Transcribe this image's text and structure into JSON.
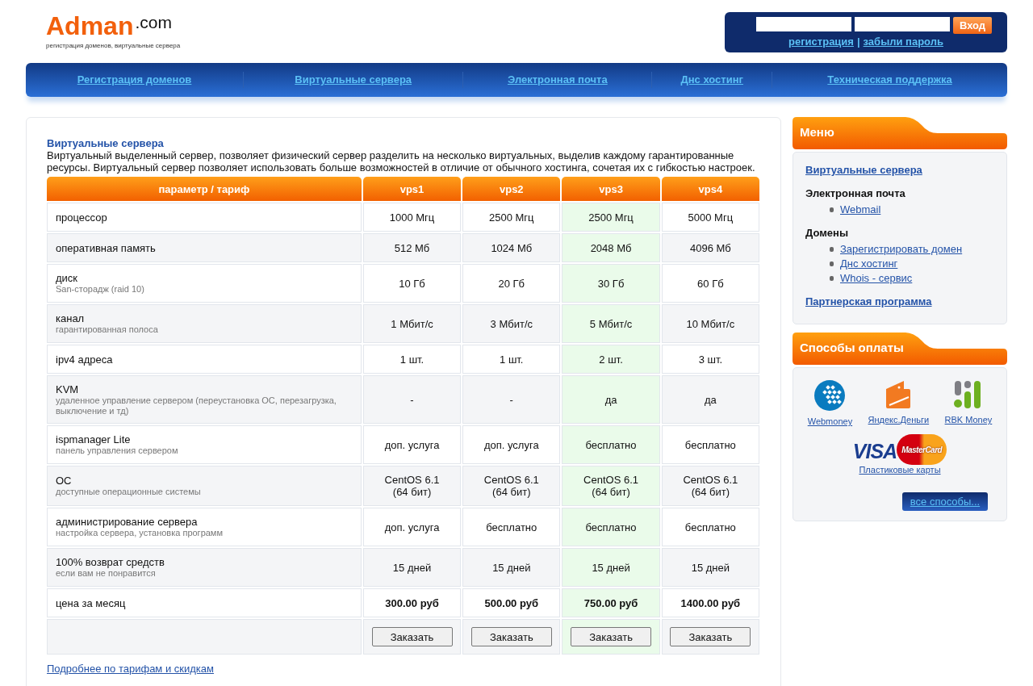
{
  "logo": {
    "name": "Adman",
    "suffix": ".com",
    "tagline": "регистрация доменов, виртуальные сервера"
  },
  "login": {
    "button": "Вход",
    "links": [
      "регистрация",
      "забыли пароль"
    ],
    "separator": "|"
  },
  "nav": [
    "Регистрация доменов",
    "Виртуальные сервера",
    "Электронная почта",
    "Днс хостинг",
    "Техническая поддержка"
  ],
  "content": {
    "title": "Виртуальные сервера",
    "description": "Виртуальный выделенный сервер, позволяет физический сервер разделить на несколько виртуальных, выделив каждому гарантированные ресурсы. Виртуальный сервер позволяет использовать больше возможностей в отличие от обычного хостинга, сочетая их с гибкостью настроек.",
    "table": {
      "columns": [
        {
          "label": "параметр / тариф",
          "selected": false
        },
        {
          "label": "vps1",
          "selected": false
        },
        {
          "label": "vps2",
          "selected": false
        },
        {
          "label": "vps3",
          "selected": true
        },
        {
          "label": "vps4",
          "selected": false
        }
      ],
      "rows": [
        {
          "kind": "text",
          "cells": [
            "процессор",
            "1000 Мгц",
            "2500 Мгц",
            "2500 Мгц",
            "5000 Мгц"
          ]
        },
        {
          "kind": "text",
          "cells": [
            "оперативная память",
            "512 Мб",
            "1024 Мб",
            "2048 Мб",
            "4096 Мб"
          ]
        },
        {
          "kind": "text",
          "note": "San-сторадж (raid 10)",
          "cells": [
            "диск",
            "10 Гб",
            "20 Гб",
            "30 Гб",
            "60 Гб"
          ]
        },
        {
          "kind": "text",
          "note": "гарантированная полоса",
          "cells": [
            "канал",
            "1 Мбит/с",
            "3 Мбит/с",
            "5 Мбит/с",
            "10 Мбит/с"
          ]
        },
        {
          "kind": "text",
          "cells": [
            "ipv4 адреса",
            "1 шт.",
            "1 шт.",
            "2 шт.",
            "3 шт."
          ]
        },
        {
          "kind": "text",
          "note": "удаленное управление сервером (переустановка ОС, перезагрузка, выключение и тд)",
          "cells": [
            "KVM",
            "-",
            "-",
            "да",
            "да"
          ]
        },
        {
          "kind": "text",
          "note": "панель управления сервером",
          "cells": [
            "ispmanager Lite",
            "доп. услуга",
            "доп. услуга",
            "бесплатно",
            "бесплатно"
          ]
        },
        {
          "kind": "text",
          "note": "доступные операционные системы",
          "cells": [
            "ОС",
            "CentOS 6.1\n(64 бит)",
            "CentOS 6.1\n(64 бит)",
            "CentOS 6.1\n(64 бит)",
            "CentOS 6.1\n(64 бит)"
          ]
        },
        {
          "kind": "text",
          "note": "настройка сервера, установка программ",
          "cells": [
            "администрирование сервера",
            "доп. услуга",
            "бесплатно",
            "бесплатно",
            "бесплатно"
          ]
        },
        {
          "kind": "text",
          "note": "если вам не понравится",
          "cells": [
            "100% возврат средств",
            "15 дней",
            "15 дней",
            "15 дней",
            "15 дней"
          ]
        },
        {
          "kind": "price",
          "cells": [
            "цена за месяц",
            "300.00 руб",
            "500.00 руб",
            "750.00 руб",
            "1400.00 руб"
          ]
        },
        {
          "kind": "order",
          "cells": [
            "",
            "Заказать",
            "Заказать",
            "Заказать",
            "Заказать"
          ]
        }
      ]
    },
    "footer_link": "Подробнее по тарифам и скидкам"
  },
  "sidebar": {
    "menu": {
      "title": "Меню",
      "sections": [
        {
          "kind": "link",
          "label": "Виртуальные сервера"
        },
        {
          "kind": "heading",
          "label": "Электронная почта",
          "children": [
            {
              "label": "Webmail"
            }
          ]
        },
        {
          "kind": "heading",
          "label": "Домены",
          "children": [
            {
              "label": "Зарегистрировать домен"
            },
            {
              "label": "Днс хостинг"
            },
            {
              "label": "Whois - сервис"
            }
          ]
        },
        {
          "kind": "link",
          "label": "Партнерская программа"
        }
      ]
    },
    "payment": {
      "title": "Способы оплаты",
      "methods": [
        {
          "kind": "webmoney",
          "label": "Webmoney"
        },
        {
          "kind": "yandex",
          "label": "Яндекс.Деньги"
        },
        {
          "kind": "rbk",
          "label": "RBK Money"
        }
      ],
      "cards": {
        "visa": "VISA",
        "mastercard": "MasterCard",
        "label": "Пластиковые карты"
      },
      "button": "все способы..."
    }
  }
}
